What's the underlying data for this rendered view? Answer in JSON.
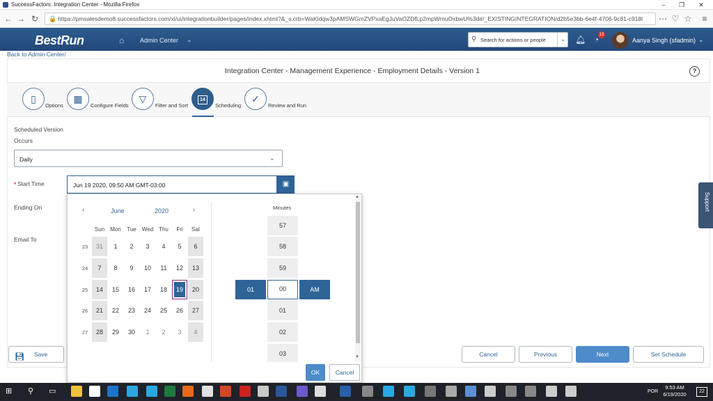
{
  "browser": {
    "window_title": "SuccessFactors: Integration Center - Mozilla Firefox",
    "url": "https://pmsalesdemo8.successfactors.com/xi/ui/integrationbuilder/pages/index.xhtml?&_s.crb=WaKldqw3pAMSWGmZVPxaEgJuVaOZDfLp2mpWmuOxbwU%3d#/_EXISTINGINTEGRATION/d2b5e3bb-6e4f-4706-9c81-c918044840d..."
  },
  "header": {
    "logo": "BestRun",
    "nav_label": "Admin Center",
    "search_placeholder": "Search for actions or people",
    "notification_count": "13",
    "user": "Aanya Singh (sfadmin)"
  },
  "back_link": "Back to Admin Center/",
  "page_title": "Integration Center - Management Experience - Employment Details - Version 1",
  "wizard": {
    "steps": [
      {
        "label": "Options",
        "icon": "document-icon"
      },
      {
        "label": "Configure Fields",
        "icon": "grid-icon"
      },
      {
        "label": "Filter and Sort",
        "icon": "filter-icon"
      },
      {
        "label": "Scheduling",
        "icon": "calendar-icon",
        "day": "14"
      },
      {
        "label": "Review and Run",
        "icon": "check-icon"
      }
    ]
  },
  "form": {
    "scheduled_version": "Scheduled Version",
    "occurs_label": "Occurs",
    "occurs_value": "Daily",
    "start_time_label": "Start Time",
    "required_marker": "*",
    "start_time_value": "Jun 19 2020, 09:50 AM GMT-03:00",
    "ending_on_label": "Ending On",
    "email_to_label": "Email To"
  },
  "calendar": {
    "month": "June",
    "year": "2020",
    "weekdays": [
      "Sun",
      "Mon",
      "Tue",
      "Wed",
      "Thu",
      "Fri",
      "Sat"
    ],
    "weeks": [
      {
        "num": "23",
        "days": [
          "31",
          "1",
          "2",
          "3",
          "4",
          "5",
          "6"
        ]
      },
      {
        "num": "24",
        "days": [
          "7",
          "8",
          "9",
          "10",
          "11",
          "12",
          "13"
        ]
      },
      {
        "num": "25",
        "days": [
          "14",
          "15",
          "16",
          "17",
          "18",
          "19",
          "20"
        ]
      },
      {
        "num": "26",
        "days": [
          "21",
          "22",
          "23",
          "24",
          "25",
          "26",
          "27"
        ]
      },
      {
        "num": "27",
        "days": [
          "28",
          "29",
          "30",
          "1",
          "2",
          "3",
          "4"
        ]
      }
    ],
    "selected_day": "19"
  },
  "time_picker": {
    "minutes_label": "Minutes",
    "minutes": [
      "57",
      "58",
      "59",
      "00",
      "01",
      "02",
      "03"
    ],
    "hour": "01",
    "ampm": "AM",
    "ok": "OK",
    "cancel": "Cancel"
  },
  "support_tab": "Support",
  "footer": {
    "save": "Save",
    "cancel": "Cancel",
    "previous": "Previous",
    "next": "Next",
    "set_schedule": "Set Schedule"
  },
  "taskbar": {
    "language": "POR",
    "time": "9:53 AM",
    "date": "6/19/2020",
    "notification_count": "22"
  },
  "colors": {
    "shell_blue": "#2d5b8e",
    "accent": "#2f6497",
    "primary_button": "#4d8bc9"
  }
}
